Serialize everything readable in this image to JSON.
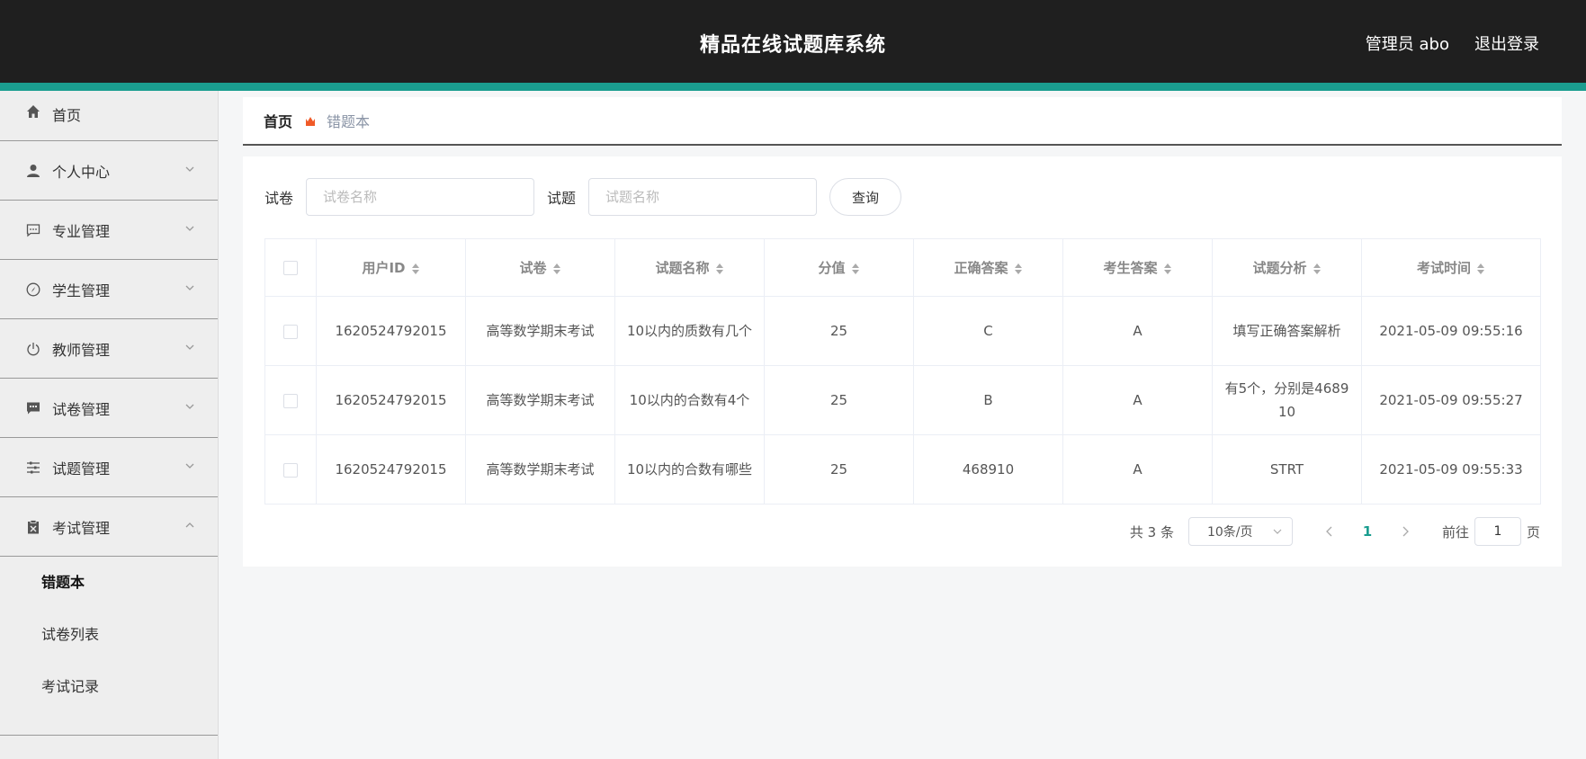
{
  "header": {
    "title": "精品在线试题库系统",
    "user_label": "管理员 abo",
    "logout_label": "退出登录"
  },
  "sidebar": {
    "items": [
      {
        "label": "首页",
        "icon": "home-icon"
      },
      {
        "label": "个人中心",
        "icon": "user-icon"
      },
      {
        "label": "专业管理",
        "icon": "chat-icon"
      },
      {
        "label": "学生管理",
        "icon": "compass-icon"
      },
      {
        "label": "教师管理",
        "icon": "power-icon"
      },
      {
        "label": "试卷管理",
        "icon": "message-icon"
      },
      {
        "label": "试题管理",
        "icon": "sliders-icon"
      },
      {
        "label": "考试管理",
        "icon": "clipboard-icon"
      }
    ],
    "subitems": [
      {
        "label": "错题本",
        "active": true
      },
      {
        "label": "试卷列表"
      },
      {
        "label": "考试记录"
      }
    ]
  },
  "breadcrumb": {
    "home": "首页",
    "current": "错题本",
    "separator_icon": "flower-icon",
    "separator_color": "#f05a28"
  },
  "search": {
    "paper_label": "试卷",
    "paper_placeholder": "试卷名称",
    "question_label": "试题",
    "question_placeholder": "试题名称",
    "query_label": "查询"
  },
  "table": {
    "columns": [
      "用户ID",
      "试卷",
      "试题名称",
      "分值",
      "正确答案",
      "考生答案",
      "试题分析",
      "考试时间"
    ],
    "rows": [
      [
        "1620524792015",
        "高等数学期末考试",
        "10以内的质数有几个",
        "25",
        "C",
        "A",
        "填写正确答案解析",
        "2021-05-09 09:55:16"
      ],
      [
        "1620524792015",
        "高等数学期末考试",
        "10以内的合数有4个",
        "25",
        "B",
        "A",
        "有5个，分别是4689 10",
        "2021-05-09 09:55:27"
      ],
      [
        "1620524792015",
        "高等数学期末考试",
        "10以内的合数有哪些",
        "25",
        "468910",
        "A",
        "STRT",
        "2021-05-09 09:55:33"
      ]
    ]
  },
  "pagination": {
    "total": "共 3 条",
    "page_size": "10条/页",
    "current_page": "1",
    "goto_label": "前往",
    "goto_value": "1",
    "page_suffix": "页"
  },
  "colors": {
    "header_bg": "#1f1f1f",
    "accent": "#1a9d8f"
  }
}
